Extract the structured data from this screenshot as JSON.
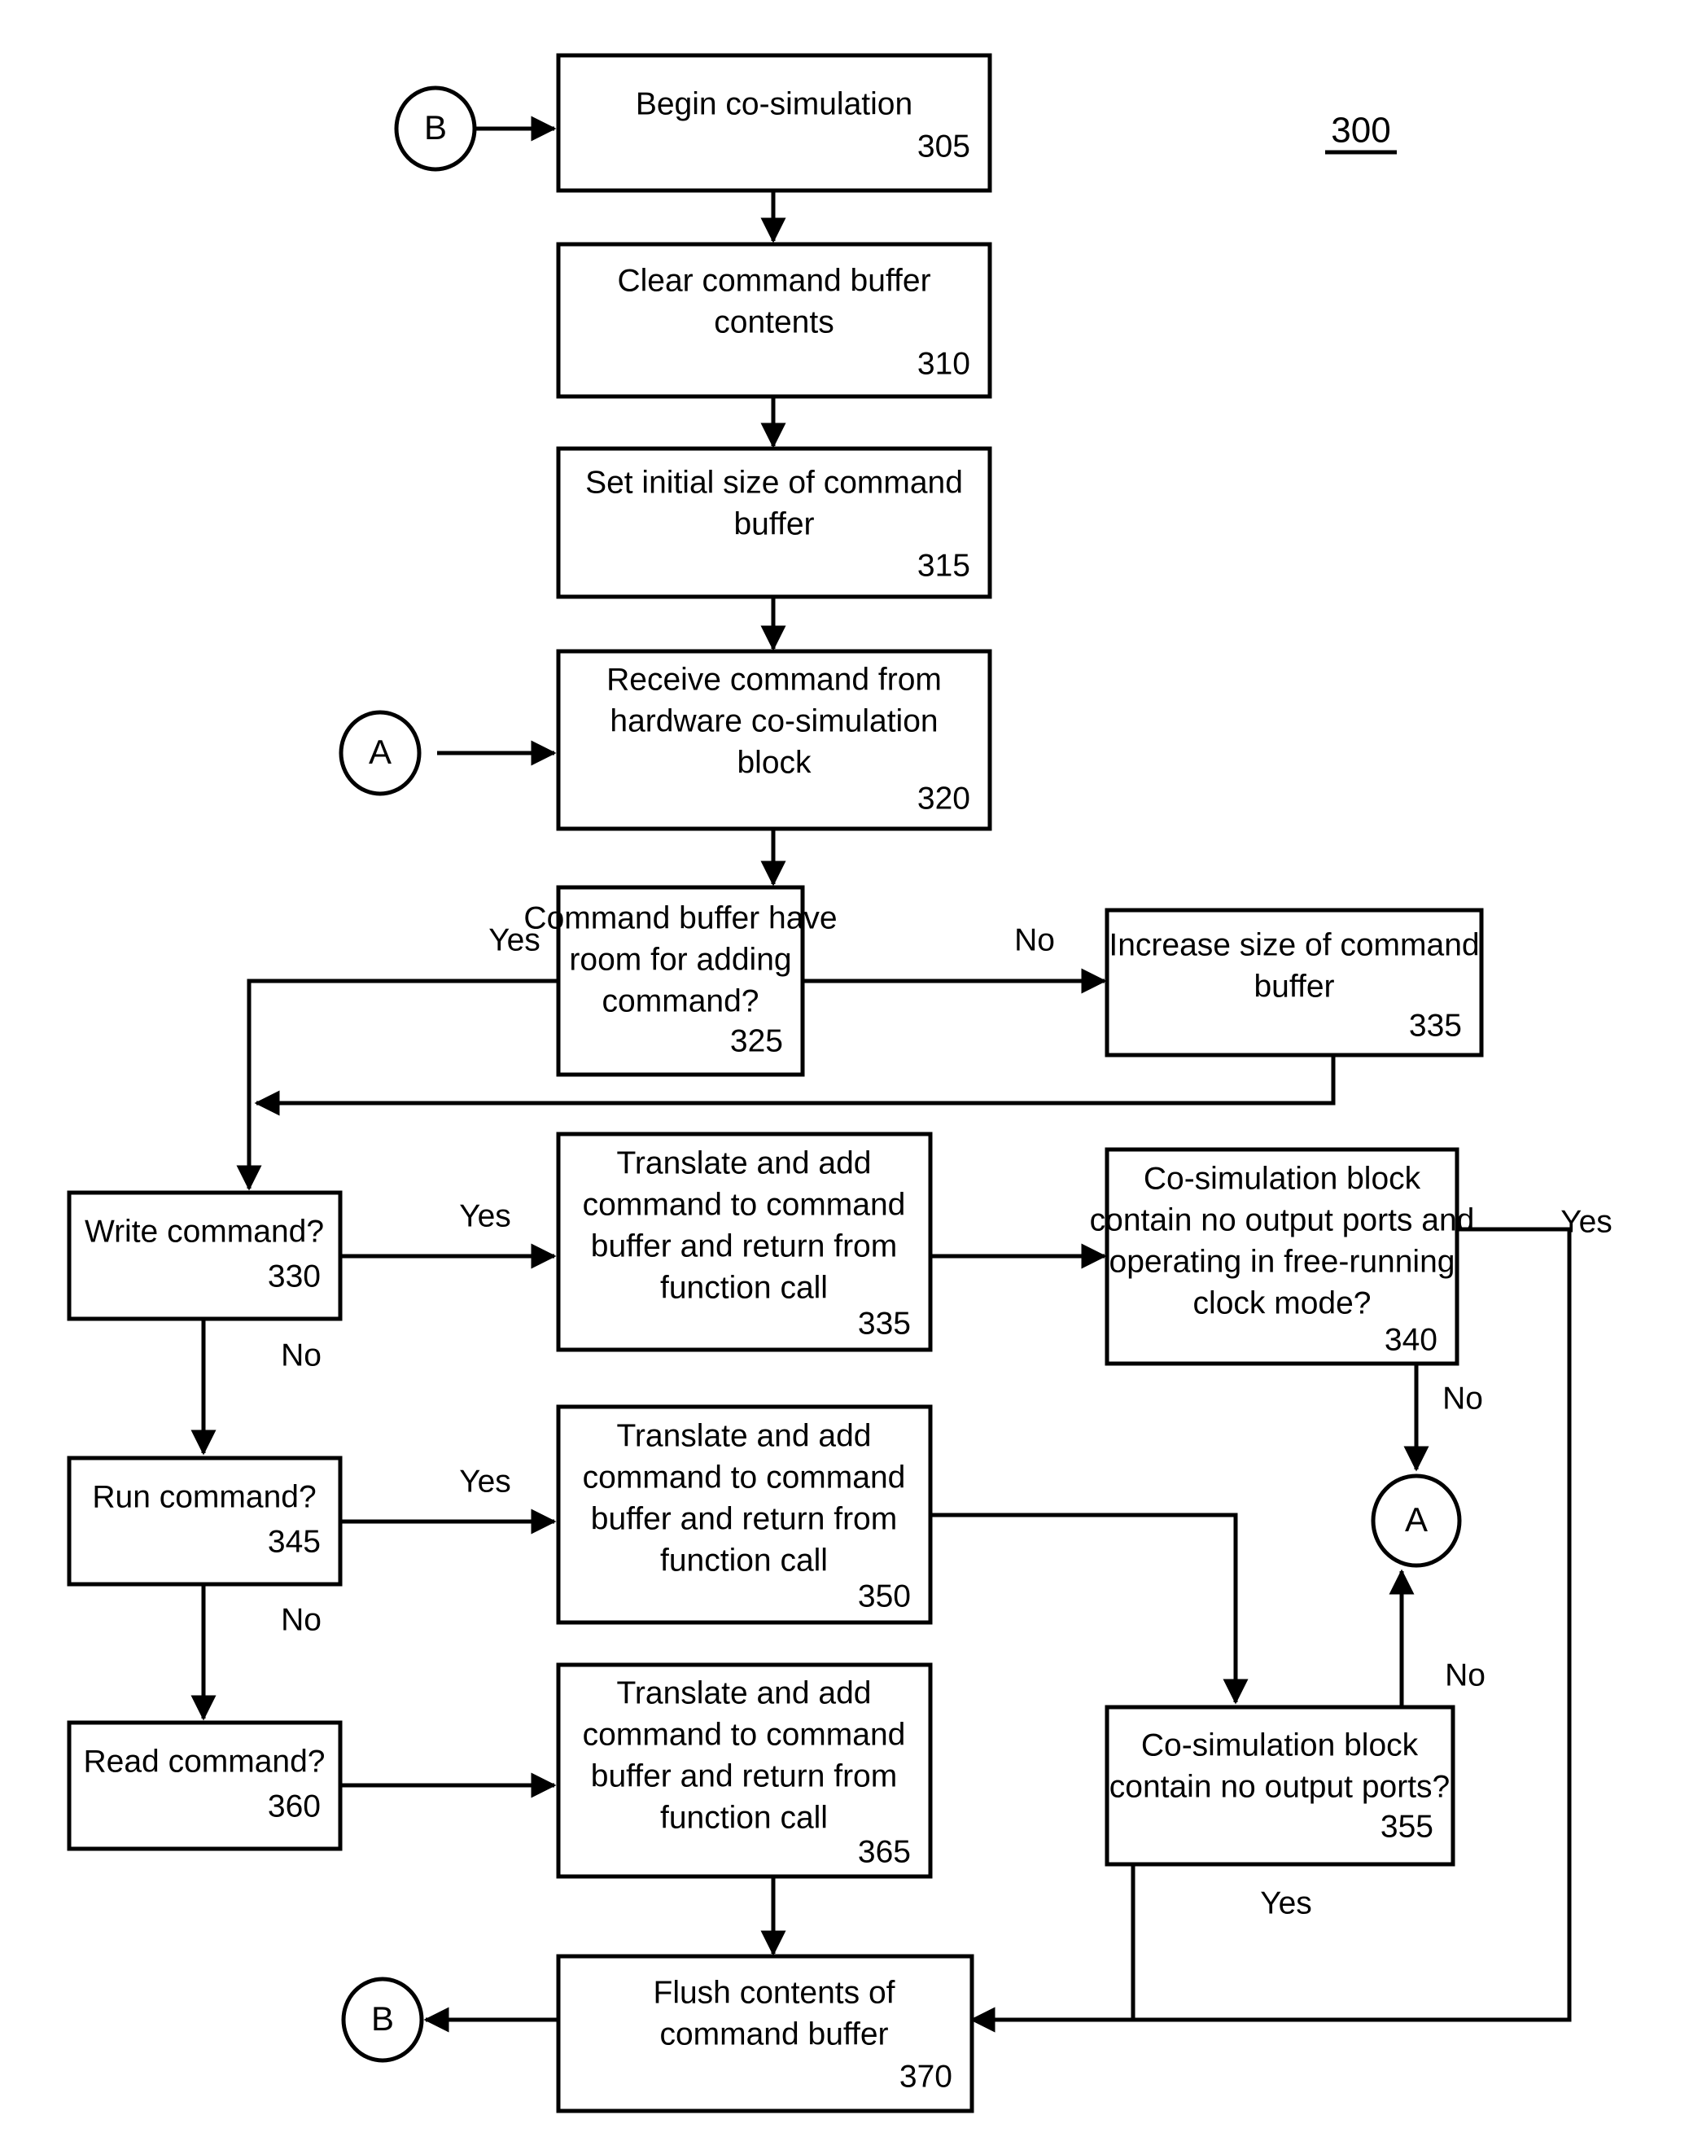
{
  "figure": {
    "label": "300",
    "title": "Hardware co-simulation command buffering flowchart"
  },
  "connectors": {
    "b_top": "B",
    "a_left": "A",
    "a_right": "A",
    "b_bottom": "B"
  },
  "nodes": {
    "n305": {
      "text": [
        "Begin co-simulation"
      ],
      "ref": "305"
    },
    "n310": {
      "text": [
        "Clear command buffer",
        "contents"
      ],
      "ref": "310"
    },
    "n315": {
      "text": [
        "Set initial size of command",
        "buffer"
      ],
      "ref": "315"
    },
    "n320": {
      "text": [
        "Receive command from",
        "hardware co-simulation",
        "block"
      ],
      "ref": "320"
    },
    "n325": {
      "text": [
        "Command buffer have",
        "room for adding",
        "command?"
      ],
      "ref": "325"
    },
    "n335r": {
      "text": [
        "Increase size of command",
        "buffer"
      ],
      "ref": "335"
    },
    "n330": {
      "text": [
        "Write command?"
      ],
      "ref": "330"
    },
    "n335m": {
      "text": [
        "Translate and add",
        "command to command",
        "buffer and return from",
        "function call"
      ],
      "ref": "335"
    },
    "n340": {
      "text": [
        "Co-simulation block",
        "contain no output ports and",
        "operating in free-running",
        "clock mode?"
      ],
      "ref": "340"
    },
    "n345": {
      "text": [
        "Run command?"
      ],
      "ref": "345"
    },
    "n350": {
      "text": [
        "Translate and add",
        "command to command",
        "buffer and return from",
        "function call"
      ],
      "ref": "350"
    },
    "n355": {
      "text": [
        "Co-simulation block",
        "contain no output ports?"
      ],
      "ref": "355"
    },
    "n360": {
      "text": [
        "Read command?"
      ],
      "ref": "360"
    },
    "n365": {
      "text": [
        "Translate and add",
        "command to command",
        "buffer and return from",
        "function call"
      ],
      "ref": "365"
    },
    "n370": {
      "text": [
        "Flush contents of",
        "command buffer"
      ],
      "ref": "370"
    }
  },
  "edge_labels": {
    "e325_yes": "Yes",
    "e325_no": "No",
    "e330_yes": "Yes",
    "e330_no": "No",
    "e340_yes": "Yes",
    "e340_no": "No",
    "e345_yes": "Yes",
    "e345_no": "No",
    "e355_yes": "Yes",
    "e355_no": "No"
  },
  "colors": {
    "stroke": "#000000",
    "fill": "#ffffff"
  }
}
